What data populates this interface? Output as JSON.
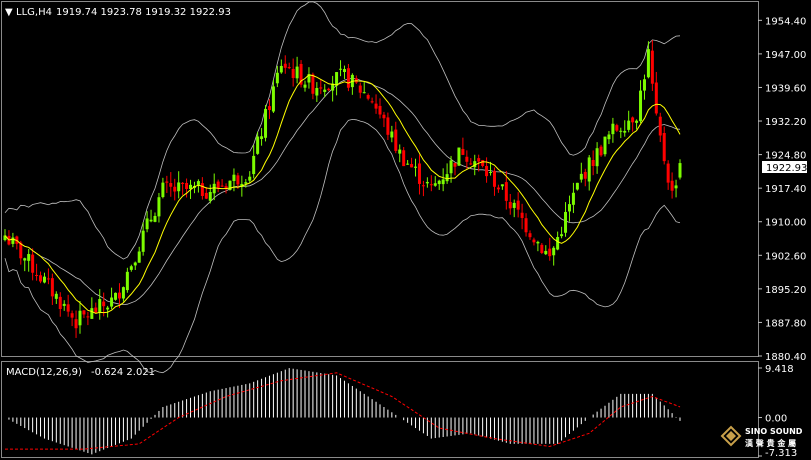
{
  "header": {
    "symbol_timeframe": "LLG,H4",
    "ohlc": "1919.74 1923.78 1919.32 1922.93",
    "macd_label": "MACD(12,26,9)",
    "macd_values": "-0.624 2.021"
  },
  "logo": {
    "text1": "SINO SOUND",
    "text2": "漢 聲 貴 金 屬"
  },
  "colors": {
    "background": "#000000",
    "bull": "#7CFC00",
    "bear": "#FF0000",
    "ma": "#FFFF00",
    "bands": "#BFBFBF",
    "signal": "#FF0000",
    "histogram": "#FFFFFF",
    "price_tag_bg": "#FFFFFF"
  },
  "chart_data": [
    {
      "type": "candlestick",
      "title": "LLG,H4",
      "ylim": [
        1880.4,
        1958.0
      ],
      "y_ticks": [
        "1954.40",
        "1947.00",
        "1939.60",
        "1932.20",
        "1924.80",
        "1917.40",
        "1910.00",
        "1902.60",
        "1895.20",
        "1887.80",
        "1880.40"
      ],
      "current_price": "1922.93",
      "moving_average": "yellow",
      "bands": "Bollinger",
      "anchors": [
        {
          "i": 0,
          "c": 1907
        },
        {
          "i": 8,
          "c": 1899
        },
        {
          "i": 18,
          "c": 1888
        },
        {
          "i": 28,
          "c": 1893
        },
        {
          "i": 40,
          "c": 1917
        },
        {
          "i": 52,
          "c": 1917
        },
        {
          "i": 62,
          "c": 1921
        },
        {
          "i": 70,
          "c": 1945
        },
        {
          "i": 78,
          "c": 1940
        },
        {
          "i": 86,
          "c": 1942
        },
        {
          "i": 93,
          "c": 1937
        },
        {
          "i": 100,
          "c": 1925
        },
        {
          "i": 108,
          "c": 1917
        },
        {
          "i": 116,
          "c": 1926
        },
        {
          "i": 124,
          "c": 1919
        },
        {
          "i": 133,
          "c": 1908
        },
        {
          "i": 138,
          "c": 1902
        },
        {
          "i": 146,
          "c": 1920
        },
        {
          "i": 154,
          "c": 1930
        },
        {
          "i": 160,
          "c": 1934
        },
        {
          "i": 163,
          "c": 1947
        },
        {
          "i": 165,
          "c": 1932
        },
        {
          "i": 169,
          "c": 1916
        },
        {
          "i": 171,
          "c": 1922.93
        }
      ]
    },
    {
      "type": "macd",
      "title": "MACD(12,26,9)",
      "ylim": [
        -7.313,
        9.418
      ],
      "y_ticks": [
        "9.418",
        "0.00",
        "-7.313"
      ],
      "histogram_anchors": [
        {
          "i": 0,
          "v": 0
        },
        {
          "i": 10,
          "v": -4
        },
        {
          "i": 22,
          "v": -7
        },
        {
          "i": 32,
          "v": -4
        },
        {
          "i": 40,
          "v": 2
        },
        {
          "i": 52,
          "v": 5
        },
        {
          "i": 62,
          "v": 6.5
        },
        {
          "i": 72,
          "v": 9.4
        },
        {
          "i": 84,
          "v": 8
        },
        {
          "i": 96,
          "v": 2
        },
        {
          "i": 108,
          "v": -4
        },
        {
          "i": 118,
          "v": -3
        },
        {
          "i": 128,
          "v": -5
        },
        {
          "i": 140,
          "v": -5
        },
        {
          "i": 148,
          "v": 0
        },
        {
          "i": 156,
          "v": 4.5
        },
        {
          "i": 164,
          "v": 4.5
        },
        {
          "i": 171,
          "v": -0.624
        }
      ],
      "signal_anchors": [
        {
          "i": 0,
          "v": -6
        },
        {
          "i": 20,
          "v": -6
        },
        {
          "i": 34,
          "v": -5
        },
        {
          "i": 44,
          "v": 0
        },
        {
          "i": 56,
          "v": 4
        },
        {
          "i": 70,
          "v": 7
        },
        {
          "i": 84,
          "v": 8.5
        },
        {
          "i": 98,
          "v": 4
        },
        {
          "i": 110,
          "v": -2
        },
        {
          "i": 124,
          "v": -4
        },
        {
          "i": 138,
          "v": -5.5
        },
        {
          "i": 148,
          "v": -3
        },
        {
          "i": 156,
          "v": 2
        },
        {
          "i": 164,
          "v": 4
        },
        {
          "i": 171,
          "v": 2.021
        }
      ]
    }
  ]
}
